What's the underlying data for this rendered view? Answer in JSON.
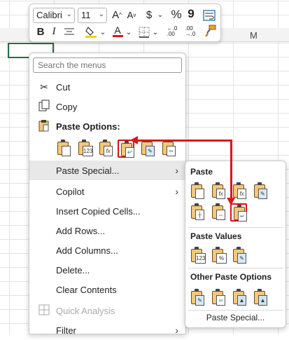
{
  "sheet": {
    "column_label": "M"
  },
  "mini_toolbar": {
    "font_name": "Calibri",
    "font_size": "11",
    "font_color": "#d71920",
    "fill_color": "#f5d000",
    "buttons": [
      "grow-font-icon",
      "shrink-font-icon",
      "accounting-format-icon",
      "percent-icon",
      "comma-style-icon",
      "wrap-text-icon",
      "bold-icon",
      "italic-icon",
      "align-center-icon",
      "fill-color-icon",
      "font-color-icon",
      "borders-icon",
      "increase-decimal-icon",
      "decrease-decimal-icon",
      "format-painter-icon"
    ],
    "glyphs": {
      "grow": "A",
      "shrink": "A",
      "dollar": "$",
      "percent": "%",
      "comma": "9",
      "bold": "B",
      "italic": "I",
      "font_color": "A",
      "dec_inc": "←.0\n.00",
      "dec_dec": ".00\n→.0"
    }
  },
  "context_menu": {
    "search_placeholder": "Search the menus",
    "items": {
      "cut": "Cut",
      "copy": "Copy",
      "paste_options": "Paste Options:",
      "paste_special": "Paste Special...",
      "copilot": "Copilot",
      "insert_copied_cells": "Insert Copied Cells...",
      "add_rows": "Add Rows...",
      "add_columns": "Add Columns...",
      "delete": "Delete...",
      "clear_contents": "Clear Contents",
      "quick_analysis": "Quick Analysis",
      "filter": "Filter"
    },
    "paste_icons": [
      "paste",
      "paste-values-123",
      "paste-formulas-fx",
      "paste-transpose",
      "paste-formatting",
      "paste-link"
    ]
  },
  "paste_submenu": {
    "paste_header": "Paste",
    "paste_values_header": "Paste Values",
    "other_header": "Other Paste Options",
    "footer": "Paste Special...",
    "badges": {
      "values": "123",
      "formula": "fx",
      "percent": "%"
    }
  },
  "colors": {
    "highlight": "#e01616",
    "menu_hover": "#e8e8e8"
  }
}
